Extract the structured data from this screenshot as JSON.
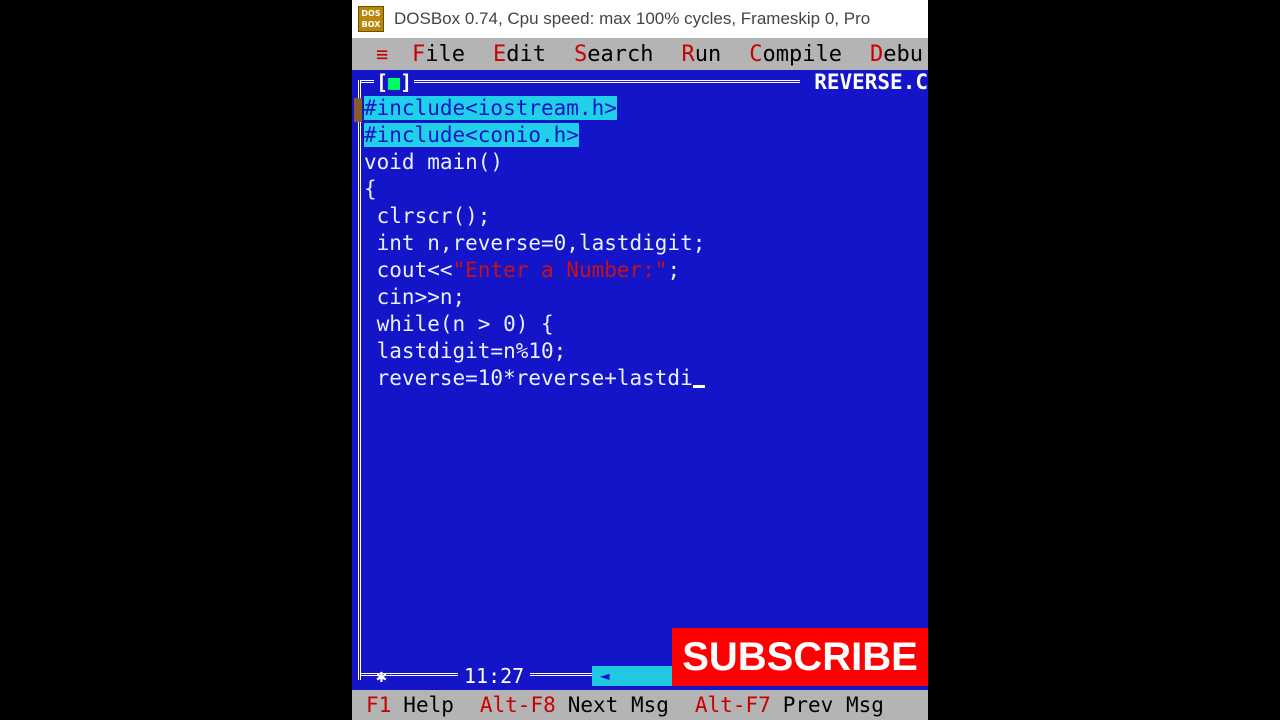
{
  "window": {
    "title": "DOSBox 0.74, Cpu speed: max 100% cycles, Frameskip  0, Pro",
    "icon_text_1": "DOS",
    "icon_text_2": "BOX"
  },
  "menubar": {
    "system_icon": "≡",
    "items": [
      {
        "hot": "F",
        "rest": "ile"
      },
      {
        "hot": "E",
        "rest": "dit"
      },
      {
        "hot": "S",
        "rest": "earch"
      },
      {
        "hot": "R",
        "rest": "un"
      },
      {
        "hot": "C",
        "rest": "ompile"
      },
      {
        "hot": "D",
        "rest": "ebu"
      }
    ]
  },
  "editor": {
    "close_box_open": "[",
    "close_box_mark": "■",
    "close_box_close": "]",
    "filename": "REVERSE.C",
    "lines": {
      "l1": "#include<iostream.h>",
      "l2": "#include<conio.h>",
      "l3": "void main()",
      "l4": "{",
      "l5": " clrscr();",
      "l6": " int n,reverse=0,lastdigit;",
      "l7_pre": " cout<<",
      "l7_str": "\"Enter a Number:\"",
      "l7_post": ";",
      "l8": " cin>>n;",
      "l9": " while(n > 0) {",
      "l10": " lastdigit=n%10;",
      "l11": " reverse=10*reverse+lastdi"
    },
    "position": "11:27",
    "scroll_arrow": "◄",
    "star": "✱"
  },
  "statusbar": {
    "items": [
      {
        "key": "F1",
        "label": "Help"
      },
      {
        "key": "Alt-F8",
        "label": "Next Msg"
      },
      {
        "key": "Alt-F7",
        "label": "Prev Msg"
      }
    ]
  },
  "overlay": {
    "subscribe_label": "SUBSCRIBE"
  },
  "colors": {
    "editor_bg": "#1414c8",
    "menubar_bg": "#b4b4b4",
    "highlight": "#20d0e8",
    "hotkey": "#c80000",
    "subscribe_bg": "#ff0000"
  }
}
